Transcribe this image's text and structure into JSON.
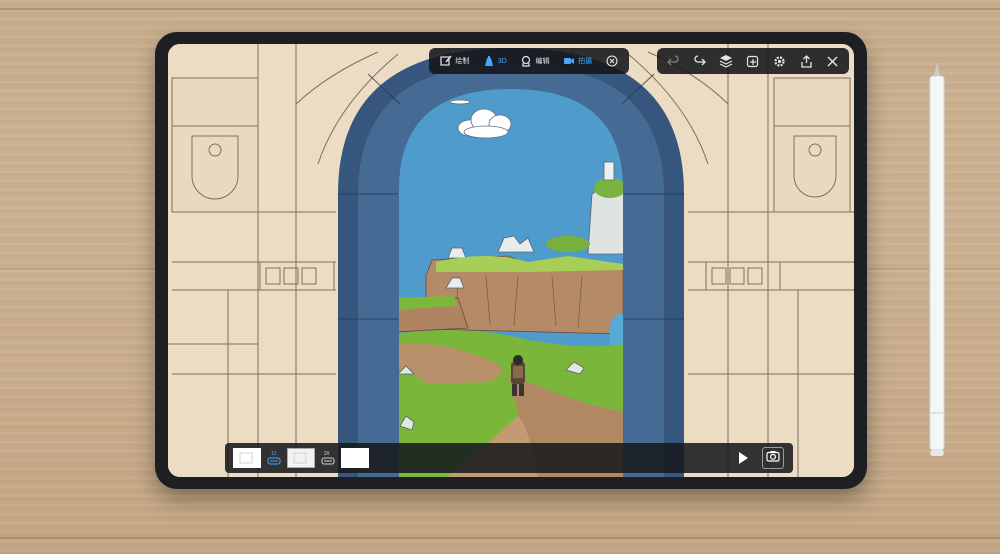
{
  "top_toolbar": {
    "draw_label": "绘制",
    "mode_3d_label": "3D",
    "edit_label": "编辑",
    "record_label": "拍摄"
  },
  "timeline": {
    "frames": [
      "1",
      "2",
      "3",
      "4"
    ]
  },
  "colors": {
    "accent": "#4aa3ff",
    "sky": "#4f9ccc",
    "arch_blue": "#3e5f86",
    "grass": "#7bb83a"
  },
  "icons": [
    "draw-icon",
    "3d-icon",
    "edit-icon",
    "record-icon",
    "close-icon",
    "undo-icon",
    "redo-icon",
    "layers-icon",
    "import-icon",
    "settings-icon",
    "share-icon",
    "exit-icon",
    "play-icon",
    "camera-icon"
  ]
}
